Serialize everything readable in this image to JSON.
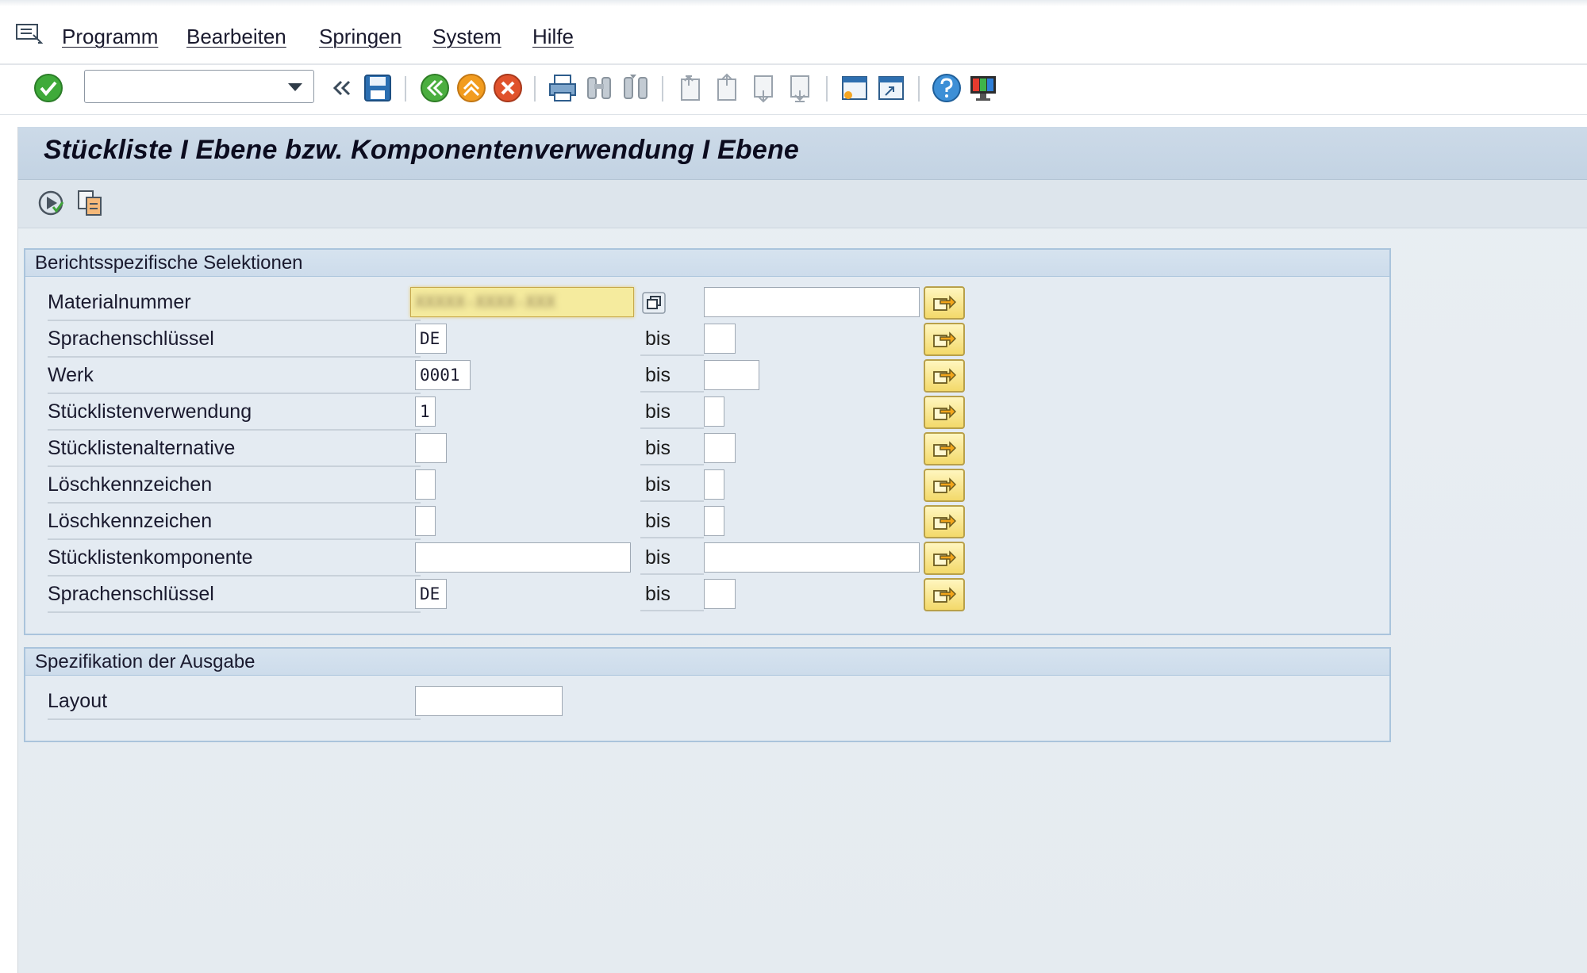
{
  "menu": {
    "items": [
      {
        "label": "Programm"
      },
      {
        "label": "Bearbeiten"
      },
      {
        "label": "Springen"
      },
      {
        "label": "System"
      },
      {
        "label": "Hilfe"
      }
    ]
  },
  "toolbar": {
    "command_value": "",
    "icons": [
      "enter-check-icon",
      "command-dropdown-icon",
      "collapse-icon",
      "save-icon",
      "back-icon",
      "exit-icon",
      "cancel-icon",
      "print-icon",
      "find-icon",
      "find-next-icon",
      "first-page-icon",
      "previous-page-icon",
      "next-page-icon",
      "last-page-icon",
      "create-session-icon",
      "create-shortcut-icon",
      "help-icon",
      "customize-layout-icon"
    ]
  },
  "page": {
    "title": "Stückliste I Ebene bzw. Komponentenverwendung I Ebene"
  },
  "app_toolbar": {
    "icons": [
      "execute-icon",
      "get-variant-icon"
    ]
  },
  "selections": {
    "header": "Berichtsspezifische Selektionen",
    "bis_label": "bis",
    "rows": [
      {
        "label": "Materialnummer",
        "low": "XXXXX-XXXX-XXX",
        "high": ""
      },
      {
        "label": "Sprachenschlüssel",
        "low": "DE",
        "high": ""
      },
      {
        "label": "Werk",
        "low": "0001",
        "high": ""
      },
      {
        "label": "Stücklistenverwendung",
        "low": "1",
        "high": ""
      },
      {
        "label": "Stücklistenalternative",
        "low": "",
        "high": ""
      },
      {
        "label": "Löschkennzeichen",
        "low": "",
        "high": ""
      },
      {
        "label": "Löschkennzeichen",
        "low": "",
        "high": ""
      },
      {
        "label": "Stücklistenkomponente",
        "low": "",
        "high": ""
      },
      {
        "label": "Sprachenschlüssel",
        "low": "DE",
        "high": ""
      }
    ]
  },
  "output": {
    "header": "Spezifikation der Ausgabe",
    "layout_label": "Layout",
    "layout_value": ""
  },
  "colors": {
    "title_bar": "#c3d3e3",
    "group_border": "#aac4dc",
    "multi_button": "#f3d96a",
    "highlight_field": "#f5eb9e"
  }
}
